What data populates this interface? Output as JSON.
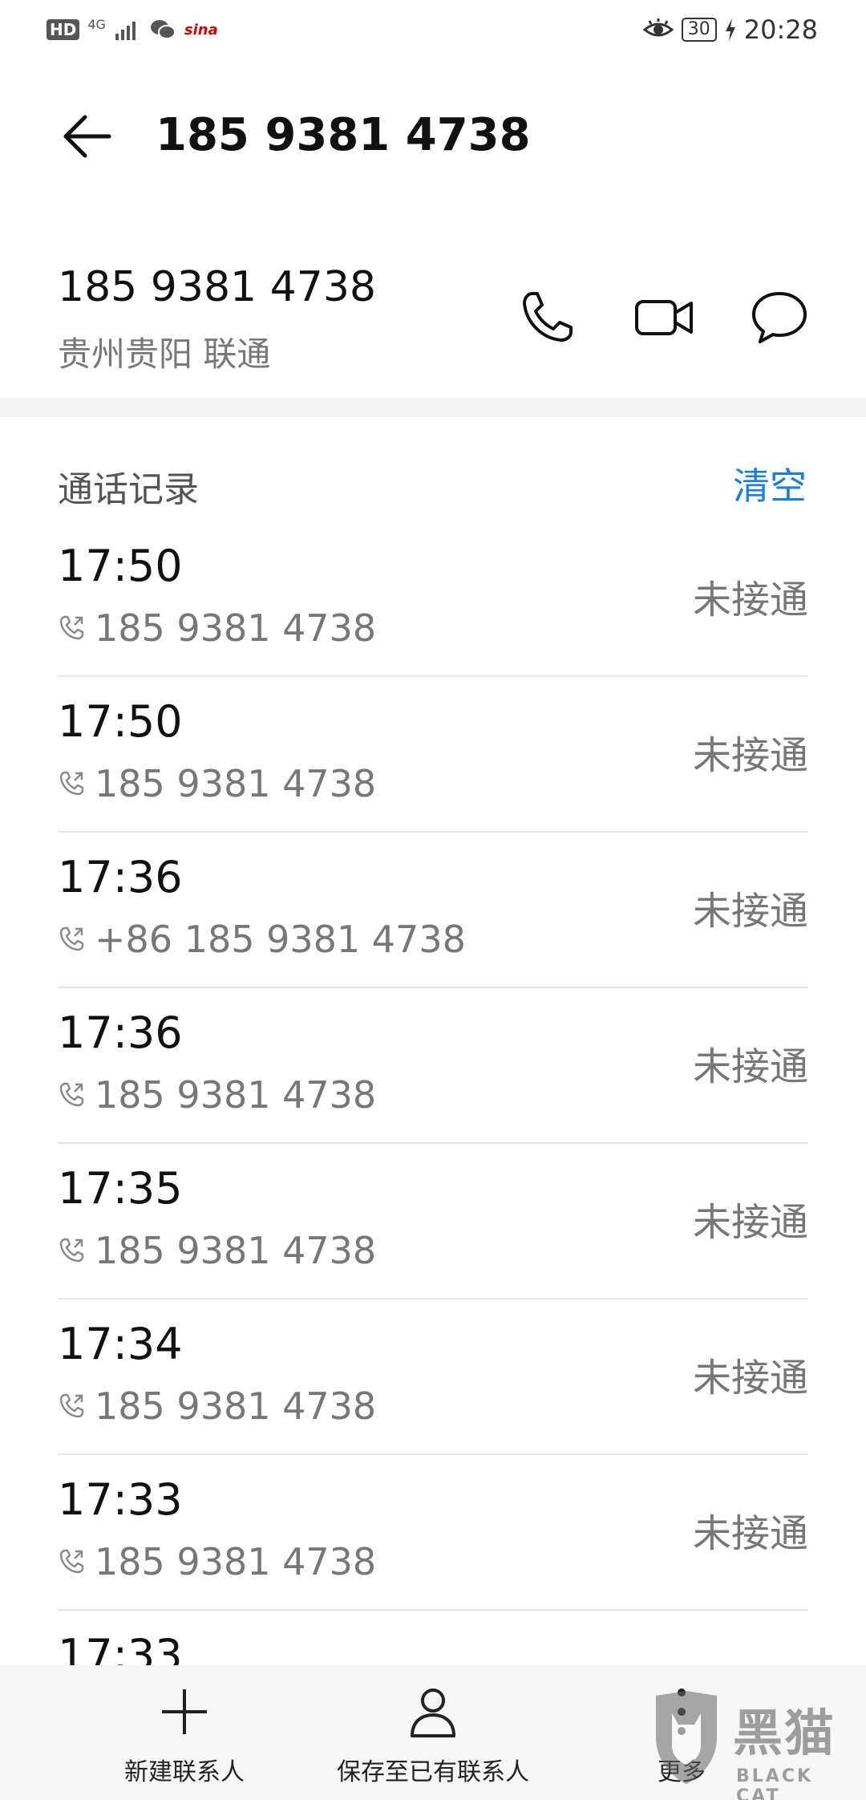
{
  "status_bar": {
    "hd": "HD",
    "network": "4G",
    "carrier_app": "sina",
    "battery": "30",
    "time": "20:28"
  },
  "header": {
    "title": "185 9381 4738"
  },
  "contact": {
    "number": "185 9381 4738",
    "location": "贵州贵阳 联通"
  },
  "call_log": {
    "title": "通话记录",
    "clear_label": "清空",
    "entries": [
      {
        "time": "17:50",
        "number": "185 9381 4738",
        "status": "未接通"
      },
      {
        "time": "17:50",
        "number": "185 9381 4738",
        "status": "未接通"
      },
      {
        "time": "17:36",
        "number": "+86 185 9381 4738",
        "status": "未接通"
      },
      {
        "time": "17:36",
        "number": "185 9381 4738",
        "status": "未接通"
      },
      {
        "time": "17:35",
        "number": "185 9381 4738",
        "status": "未接通"
      },
      {
        "time": "17:34",
        "number": "185 9381 4738",
        "status": "未接通"
      },
      {
        "time": "17:33",
        "number": "185 9381 4738",
        "status": "未接通"
      },
      {
        "time": "17:33",
        "number": "",
        "status": ""
      }
    ]
  },
  "bottom_bar": {
    "new_contact": "新建联系人",
    "save_existing": "保存至已有联系人",
    "more": "更多"
  },
  "watermark": {
    "main": "黑猫",
    "sub": "BLACK CAT"
  },
  "colors": {
    "accent": "#1a7fd6",
    "secondary_text": "#777777",
    "divider": "#e6e6e6"
  }
}
